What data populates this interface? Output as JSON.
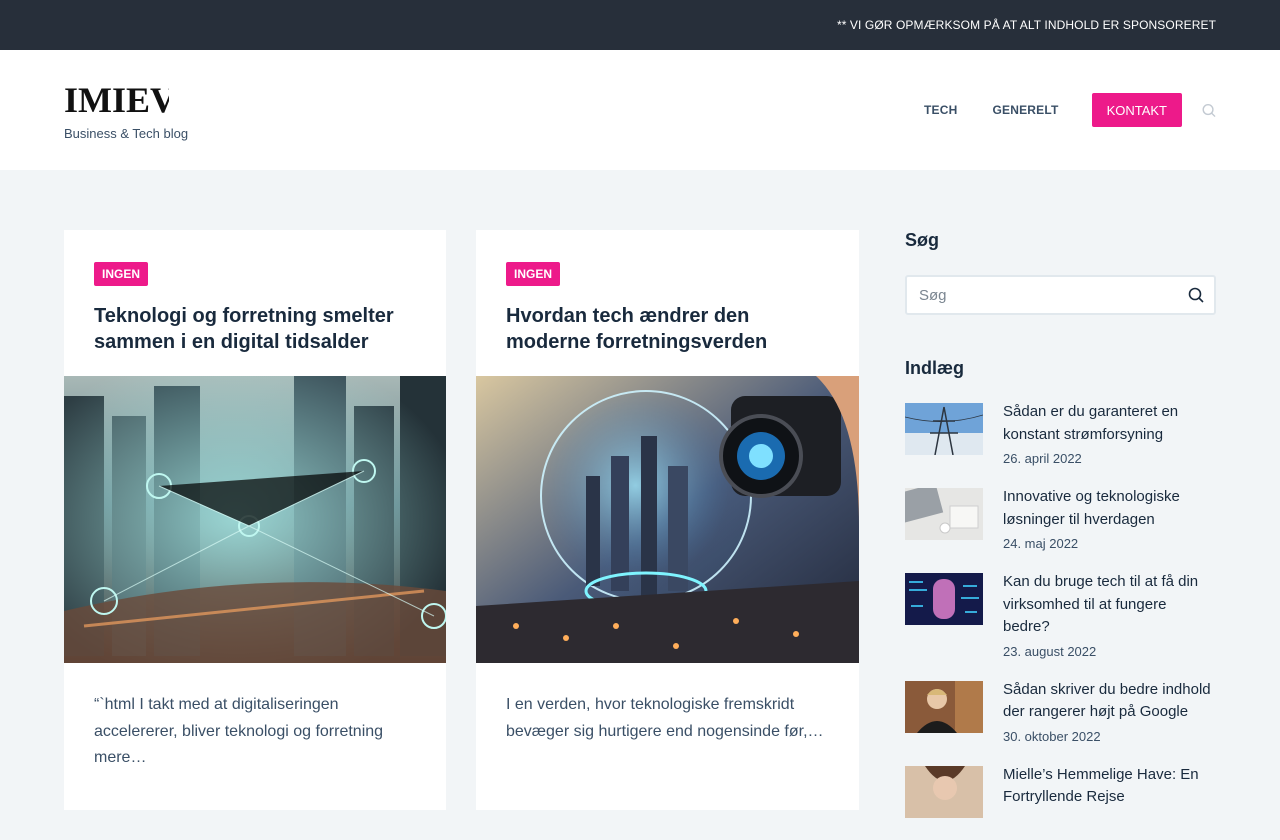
{
  "topbar": {
    "notice": "** VI GØR OPMÆRKSOM PÅ AT ALT INDHOLD ER SPONSORERET"
  },
  "header": {
    "logo": "IMIEV",
    "tagline": "Business & Tech blog",
    "nav": [
      {
        "label": "TECH"
      },
      {
        "label": "GENERELT"
      }
    ],
    "contact_label": "KONTAKT"
  },
  "cards": [
    {
      "category": "INGEN",
      "title": "Teknologi og forretning smelter sammen i en digital tidsalder",
      "excerpt": "“`html I takt med at digitaliseringen accelererer, bliver teknologi og forretning mere…"
    },
    {
      "category": "INGEN",
      "title": "Hvordan tech ændrer den moderne forretningsverden",
      "excerpt": "I en verden, hvor teknologiske fremskridt bevæger sig hurtigere end nogensinde før,…"
    }
  ],
  "sidebar": {
    "search_heading": "Søg",
    "search_placeholder": "Søg",
    "posts_heading": "Indlæg",
    "posts": [
      {
        "title": "Sådan er du garanteret en konstant strømforsyning",
        "date": "26. april 2022"
      },
      {
        "title": "Innovative og teknologiske løsninger til hverdagen",
        "date": "24. maj 2022"
      },
      {
        "title": "Kan du bruge tech til at få din virksomhed til at fungere bedre?",
        "date": "23. august 2022"
      },
      {
        "title": "Sådan skriver du bedre indhold der rangerer højt på Google",
        "date": "30. oktober 2022"
      },
      {
        "title": "Mielle’s Hemmelige Have: En Fortryllende Rejse",
        "date": ""
      }
    ]
  },
  "colors": {
    "accent": "#ed1a8a",
    "topbar": "#272f3a",
    "heading": "#192a3d",
    "text": "#3a4f66"
  },
  "icons": {
    "header_search": "search-icon",
    "sidebar_search": "search-icon"
  }
}
